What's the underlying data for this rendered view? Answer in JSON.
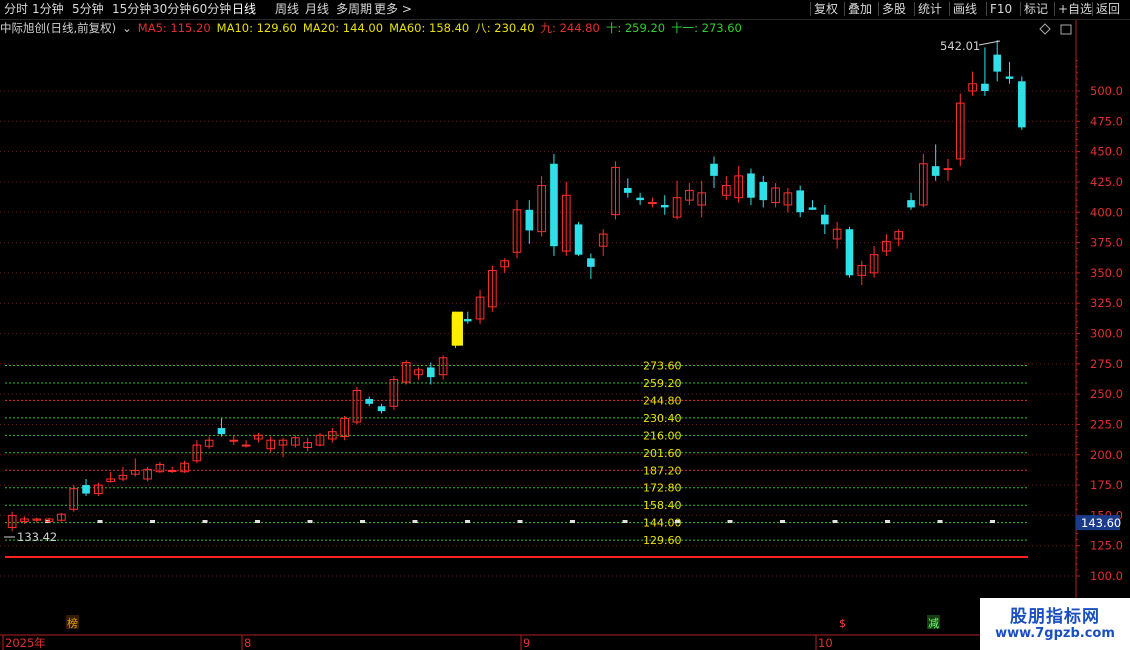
{
  "toolbar": {
    "periods": [
      "分时",
      "1分钟",
      "5分钟",
      "15分钟",
      "30分钟",
      "60分钟",
      "日线",
      "周线",
      "月线",
      "多周期",
      "更多 >"
    ],
    "active": "日线",
    "right": [
      "复权",
      "叠加",
      "多股",
      "统计",
      "画线",
      "F10",
      "标记",
      "+自选",
      "返回"
    ]
  },
  "info": {
    "title": "中际旭创(日线,前复权)",
    "dropdown": "⌄",
    "ma": [
      {
        "label": "MA5: 115.20",
        "color": "#e03030"
      },
      {
        "label": "MA10: 129.60",
        "color": "#e8e000"
      },
      {
        "label": "MA20: 144.00",
        "color": "#e8e000"
      },
      {
        "label": "MA60: 158.40",
        "color": "#e8e000"
      },
      {
        "label": "八: 230.40",
        "color": "#e8e000"
      },
      {
        "label": "九: 244.80",
        "color": "#e03030"
      },
      {
        "label": "十: 259.20",
        "color": "#30d030"
      },
      {
        "label": "十一: 273.60",
        "color": "#30d030"
      }
    ]
  },
  "axis": {
    "ticks": [
      500,
      475,
      450,
      425,
      400,
      375,
      350,
      325,
      300,
      275,
      250,
      225,
      200,
      175,
      150,
      125,
      100
    ],
    "labels": [
      "500.0",
      "475.0",
      "450.0",
      "425.0",
      "400.0",
      "375.0",
      "350.0",
      "325.0",
      "300.0",
      "275.0",
      "250.0",
      "225.0",
      "200.0",
      "175.0",
      "150.0",
      "125.0",
      "100.0"
    ],
    "current": "143.60",
    "high_label": "542.01",
    "low_label": "133.42"
  },
  "levels": {
    "values": [
      273.6,
      259.2,
      244.8,
      230.4,
      216,
      201.6,
      187.2,
      172.8,
      158.4,
      144,
      129.6
    ],
    "labels": [
      "273.60",
      "259.20",
      "244.80",
      "230.40",
      "216.00",
      "201.60",
      "187.20",
      "172.80",
      "158.40",
      "144.00",
      "129.60"
    ],
    "colors": [
      "#30c030",
      "#30c030",
      "#e03030",
      "#30c030",
      "#30c030",
      "#30c030",
      "#e03030",
      "#30c030",
      "#30c030",
      "#30c030",
      "#30c030"
    ]
  },
  "xaxis": {
    "labels": [
      "2025年",
      "8",
      "9",
      "10"
    ]
  },
  "markers": [
    "榜",
    "$",
    "减"
  ],
  "chart_data": {
    "type": "candlestick",
    "ylim": [
      100,
      550
    ],
    "candles": [
      [
        140,
        150,
        137,
        153
      ],
      [
        145,
        147,
        143,
        149
      ],
      [
        146,
        147,
        144,
        148
      ],
      [
        145,
        147,
        144,
        148
      ],
      [
        146,
        151,
        145,
        152
      ],
      [
        155,
        172,
        153,
        175
      ],
      [
        175,
        168,
        166,
        180
      ],
      [
        168,
        175,
        166,
        177
      ],
      [
        178,
        180,
        177,
        186
      ],
      [
        180,
        183,
        178,
        190
      ],
      [
        184,
        187,
        182,
        197
      ],
      [
        180,
        188,
        178,
        190
      ],
      [
        186,
        192,
        185,
        194
      ],
      [
        187,
        187,
        185,
        190
      ],
      [
        186,
        193,
        185,
        195
      ],
      [
        195,
        208,
        193,
        212
      ],
      [
        207,
        212,
        205,
        215
      ],
      [
        222,
        217,
        215,
        230
      ],
      [
        212,
        212,
        208,
        216
      ],
      [
        208,
        208,
        206,
        212
      ],
      [
        213,
        216,
        210,
        218
      ],
      [
        205,
        212,
        202,
        215
      ],
      [
        208,
        212,
        198,
        214
      ],
      [
        208,
        214,
        206,
        216
      ],
      [
        206,
        210,
        203,
        214
      ],
      [
        208,
        216,
        207,
        218
      ],
      [
        213,
        219,
        210,
        222
      ],
      [
        215,
        230,
        212,
        232
      ],
      [
        227,
        253,
        225,
        256
      ],
      [
        246,
        242,
        240,
        248
      ],
      [
        240,
        236,
        234,
        242
      ],
      [
        240,
        262,
        237,
        265
      ],
      [
        260,
        276,
        258,
        278
      ],
      [
        266,
        270,
        262,
        272
      ],
      [
        272,
        264,
        258,
        276
      ],
      [
        266,
        280,
        262,
        282
      ],
      [
        316,
        290,
        288,
        318
      ],
      [
        312,
        310,
        308,
        318
      ],
      [
        312,
        330,
        308,
        336
      ],
      [
        322,
        352,
        318,
        356
      ],
      [
        355,
        360,
        350,
        362
      ],
      [
        367,
        402,
        362,
        410
      ],
      [
        402,
        385,
        374,
        410
      ],
      [
        384,
        422,
        380,
        430
      ],
      [
        440,
        372,
        364,
        448
      ],
      [
        368,
        414,
        364,
        425
      ],
      [
        390,
        365,
        364,
        392
      ],
      [
        362,
        355,
        345,
        366
      ],
      [
        372,
        382,
        364,
        386
      ],
      [
        398,
        437,
        394,
        442
      ],
      [
        420,
        416,
        412,
        428
      ],
      [
        412,
        410,
        406,
        416
      ],
      [
        408,
        408,
        404,
        412
      ],
      [
        406,
        404,
        398,
        414
      ],
      [
        396,
        412,
        394,
        426
      ],
      [
        410,
        418,
        406,
        424
      ],
      [
        406,
        416,
        396,
        426
      ],
      [
        440,
        430,
        420,
        446
      ],
      [
        414,
        422,
        410,
        430
      ],
      [
        412,
        430,
        408,
        438
      ],
      [
        432,
        412,
        406,
        436
      ],
      [
        425,
        410,
        404,
        430
      ],
      [
        408,
        420,
        404,
        424
      ],
      [
        406,
        416,
        400,
        420
      ],
      [
        418,
        400,
        396,
        422
      ],
      [
        404,
        402,
        402,
        410
      ],
      [
        398,
        390,
        382,
        406
      ],
      [
        378,
        386,
        370,
        392
      ],
      [
        386,
        348,
        346,
        388
      ],
      [
        348,
        356,
        340,
        360
      ],
      [
        350,
        365,
        346,
        372
      ],
      [
        368,
        376,
        364,
        382
      ],
      [
        378,
        384,
        372,
        386
      ],
      [
        410,
        404,
        402,
        416
      ],
      [
        406,
        440,
        404,
        448
      ],
      [
        438,
        430,
        426,
        456
      ],
      [
        436,
        436,
        426,
        444
      ],
      [
        444,
        490,
        438,
        498
      ],
      [
        500,
        506,
        496,
        516
      ],
      [
        506,
        500,
        496,
        536
      ],
      [
        530,
        516,
        508,
        542
      ],
      [
        512,
        510,
        506,
        524
      ],
      [
        508,
        470,
        468,
        512
      ]
    ]
  }
}
